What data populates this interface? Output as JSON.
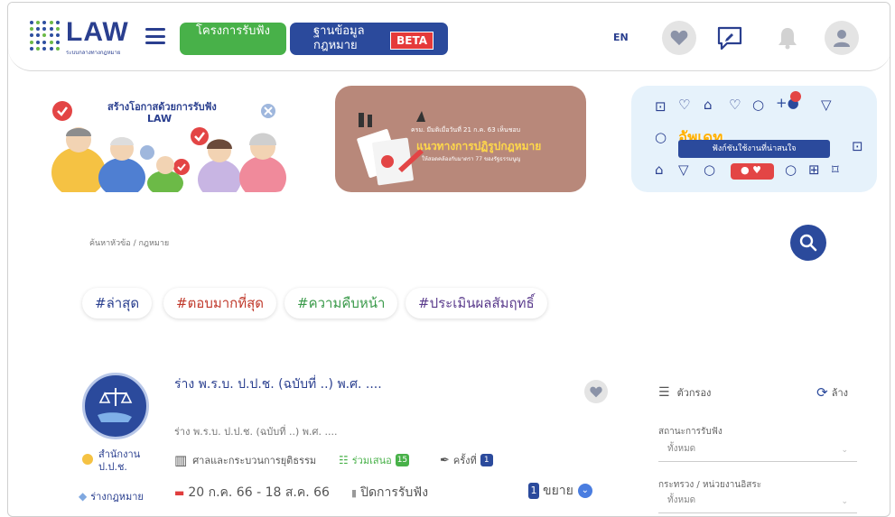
{
  "header": {
    "logo_text": "LAW",
    "logo_sub": "ระบบกลางทางกฎหมาย",
    "project_btn": "โครงการรับฟัง",
    "database_btn": "ฐานข้อมูลกฎหมาย",
    "beta": "BETA",
    "lang": "EN"
  },
  "banners": {
    "b1_title": "สร้างโอกาสด้วยการรับฟัง",
    "b1_law": "LAW",
    "b2_line1": "ครม. มีมติเมื่อวันที่ 21 ก.ค. 63 เห็นชอบ",
    "b2_title": "แนวทางการปฏิรูปกฎหมาย",
    "b2_line3": "ให้สอดคล้องกับมาตรา 77 ของรัฐธรรมนูญ",
    "b3_update": "อัพเดท",
    "b3_pill": "ฟังก์ชันใช้งานที่น่าสนใจ"
  },
  "search": {
    "placeholder": "ค้นหาหัวข้อ / กฎหมาย"
  },
  "tags": [
    "#ล่าสุด",
    "#ตอบมากที่สุด",
    "#ความคืบหน้า",
    "#ประเมินผลสัมฤทธิ์"
  ],
  "colors": {
    "primary": "#2b4a9c",
    "green": "#48b149",
    "red": "#e03d3d",
    "tag_blue": "#2a3f8f",
    "tag_red": "#c0392b",
    "tag_green": "#3a9a4a",
    "tag_purple": "#5a3b8c"
  },
  "card": {
    "title": "ร่าง พ.ร.บ. ป.ป.ช. (ฉบับที่ ..) พ.ศ. ....",
    "subtitle": "ร่าง พ.ร.บ. ป.ป.ช. (ฉบับที่ ..) พ.ศ. ....",
    "agency": "สำนักงาน ป.ป.ช.",
    "type": "ร่างกฎหมาย",
    "category": "ศาลและกระบวนการยุติธรรม",
    "participants_label": "ร่วมเสนอ",
    "participants_count": "15",
    "round_label": "ครั้งที่",
    "round_count": "1",
    "date_range": "20 ก.ค. 66 - 18 ส.ค. 66",
    "status": "ปิดการรับฟัง",
    "extend_count": "1",
    "extend_label": "ขยาย"
  },
  "filter": {
    "title": "ตัวกรอง",
    "reset": "ล้าง",
    "status_label": "สถานะการรับฟัง",
    "status_value": "ทั้งหมด",
    "ministry_label": "กระทรวง / หน่วยงานอิสระ",
    "ministry_value": "ทั้งหมด"
  }
}
